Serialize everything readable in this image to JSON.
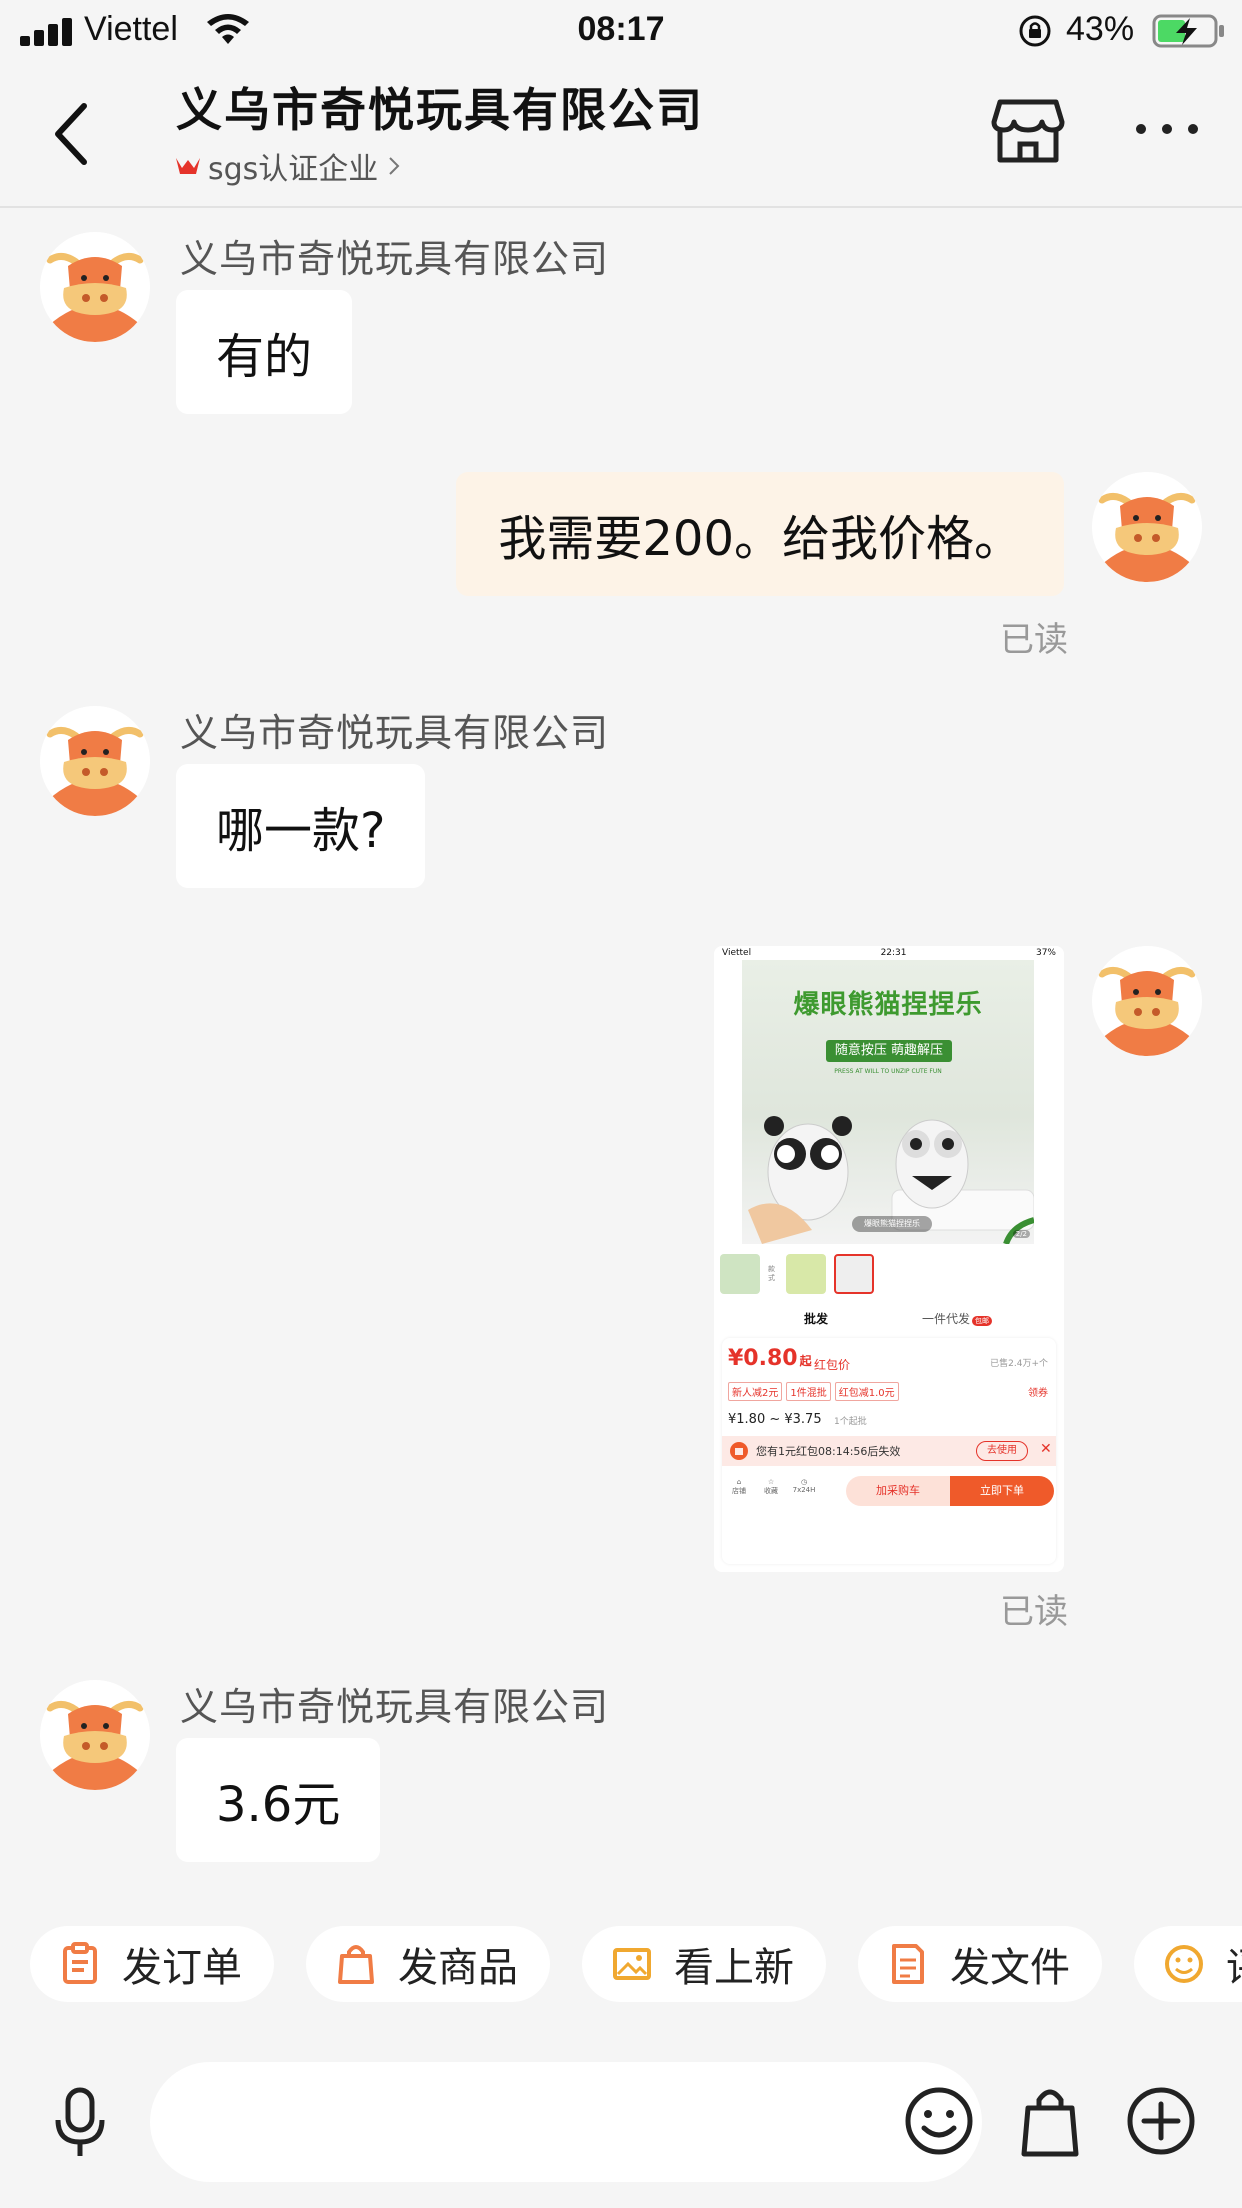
{
  "status_bar": {
    "carrier": "Viettel",
    "time": "08:17",
    "battery_pct": "43%",
    "icons": [
      "signal-icon",
      "wifi-icon",
      "orientation-lock-icon",
      "battery-charging-icon"
    ]
  },
  "header": {
    "title": "义乌市奇悦玩具有限公司",
    "subtitle": "sgs认证企业",
    "icons": [
      "back-arrow-icon",
      "certification-icon",
      "chevron-right-icon",
      "shop-icon",
      "more-icon"
    ]
  },
  "messages": [
    {
      "direction": "in",
      "sender": "义乌市奇悦玩具有限公司",
      "text": "有的"
    },
    {
      "direction": "out",
      "text": "我需要200。给我价格。",
      "status": "已读"
    },
    {
      "direction": "in",
      "sender": "义乌市奇悦玩具有限公司",
      "text": "哪一款?"
    },
    {
      "direction": "out",
      "type": "image",
      "status": "已读"
    },
    {
      "direction": "in",
      "sender": "义乌市奇悦玩具有限公司",
      "text": "3.6元"
    }
  ],
  "product_image": {
    "status_carrier": "Viettel",
    "status_time": "22:31",
    "status_battery": "37%",
    "title": "爆眼熊猫捏捏乐",
    "tagline": "随意按压 萌趣解压",
    "tagline_en": "PRESS AT WILL TO UNZIP CUTE FUN",
    "caption": "爆眼熊猫捏捏乐",
    "page_indicator": "2/2",
    "thumb_label": "款式",
    "tab_wholesale": "批发",
    "tab_dropship": "一件代发",
    "tab_dropship_badge": "包邮",
    "price": "¥0.80",
    "price_suffix": "起",
    "price_label": "红包价",
    "sold": "已售2.4万+个",
    "coupons": [
      "新人减2元",
      "1件混批",
      "红包减1.0元"
    ],
    "get_coupon": "领券",
    "price_range": "¥1.80 ~ ¥3.75",
    "min_order": "1个起批",
    "red_packet_notice": "您有1元红包08:14:56后失效",
    "use_button": "去使用",
    "bottom_icons": [
      "店铺",
      "收藏",
      "7x24H"
    ],
    "cart_button": "加采购车",
    "buy_button": "立即下单"
  },
  "quick_actions": [
    {
      "label": "发订单",
      "icon": "order-icon"
    },
    {
      "label": "发商品",
      "icon": "bag-icon"
    },
    {
      "label": "看上新",
      "icon": "image-icon"
    },
    {
      "label": "发文件",
      "icon": "file-icon"
    },
    {
      "label": "评",
      "icon": "smile-icon"
    }
  ],
  "input_bar": {
    "placeholder": "",
    "icons": [
      "microphone-icon",
      "emoji-icon",
      "bag-icon",
      "plus-icon"
    ]
  },
  "colors": {
    "background": "#f5f5f5",
    "bubble_in": "#ffffff",
    "bubble_out": "#fdf3e7",
    "accent_orange": "#f07c45",
    "muted": "#999999"
  }
}
